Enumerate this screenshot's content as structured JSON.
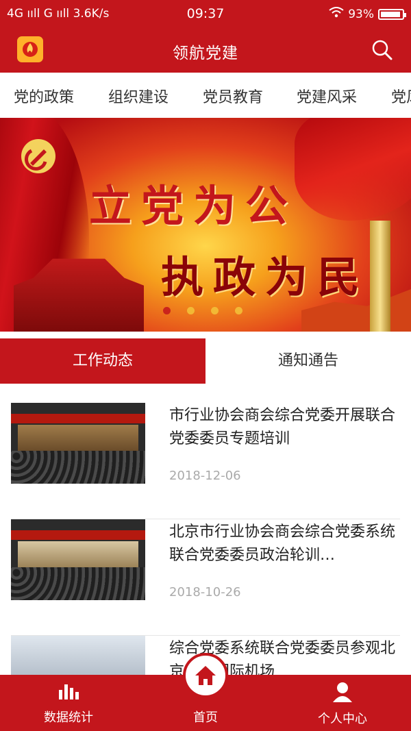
{
  "statusbar": {
    "network": "4G ııll G ııll 3.6K/s",
    "time": "09:37",
    "battery": "93%"
  },
  "header": {
    "title": "领航党建"
  },
  "tabs": [
    "党的政策",
    "组织建设",
    "党员教育",
    "党建风采",
    "党风"
  ],
  "banner": {
    "slogan_top": "立党为公",
    "slogan_bottom": "执政为民",
    "slides": 4,
    "active_slide": 1
  },
  "segments": {
    "active": "工作动态",
    "inactive": "通知通告"
  },
  "news": [
    {
      "title": "市行业协会商会综合党委开展联合党委委员专题培训",
      "date": "2018-12-06"
    },
    {
      "title": "北京市行业协会商会综合党委系统联合党委委员政治轮训…",
      "date": "2018-10-26"
    },
    {
      "title": "综合党委系统联合党委委员参观北京大兴国际机场",
      "date": ""
    }
  ],
  "bottom_nav": {
    "stats": "数据统计",
    "home": "首页",
    "profile": "个人中心"
  },
  "colors": {
    "primary": "#c3161c",
    "accent": "#ffb12a"
  }
}
